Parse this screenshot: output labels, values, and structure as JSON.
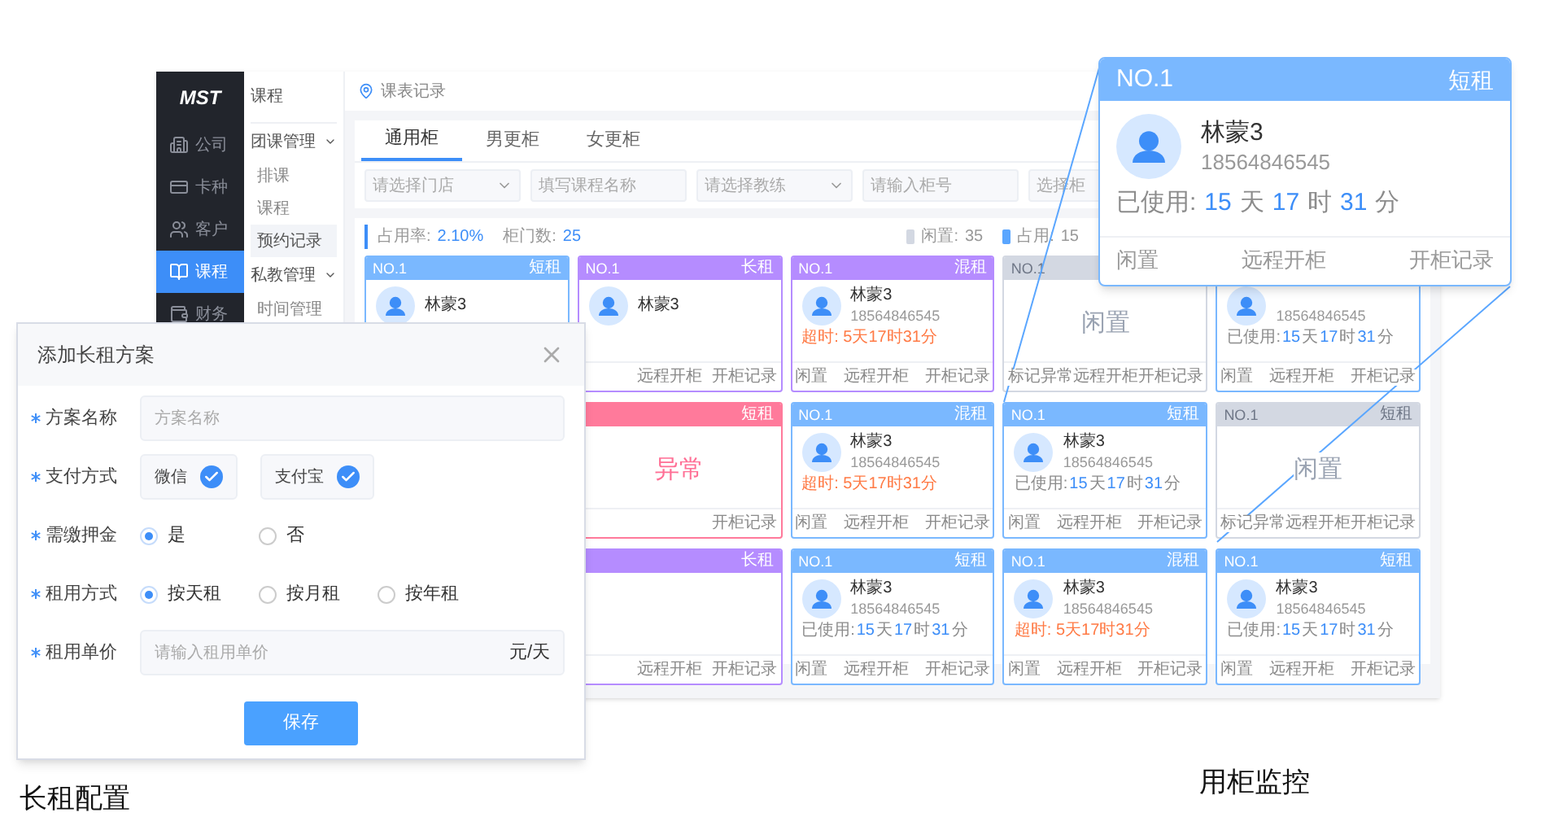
{
  "main_window": {
    "logo": "MST",
    "nav": [
      {
        "label": "公司",
        "selected": false
      },
      {
        "label": "卡种",
        "selected": false
      },
      {
        "label": "客户",
        "selected": false
      },
      {
        "label": "课程",
        "selected": true
      },
      {
        "label": "财务",
        "selected": false
      }
    ],
    "submenu": {
      "title": "课程",
      "groups": [
        {
          "label": "团课管理",
          "expanded": true,
          "children": [
            {
              "label": "排课",
              "selected": false
            },
            {
              "label": "课程",
              "selected": false
            },
            {
              "label": "预约记录",
              "selected": true
            }
          ]
        },
        {
          "label": "私教管理",
          "expanded": true,
          "children": [
            {
              "label": "时间管理",
              "selected": false
            }
          ]
        }
      ]
    },
    "breadcrumb": "课表记录",
    "tabs": [
      {
        "label": "通用柜",
        "selected": true
      },
      {
        "label": "男更柜",
        "selected": false
      },
      {
        "label": "女更柜",
        "selected": false
      }
    ],
    "filters": [
      {
        "kind": "select",
        "placeholder": "请选择门店"
      },
      {
        "kind": "input",
        "placeholder": "填写课程名称"
      },
      {
        "kind": "select",
        "placeholder": "请选择教练"
      },
      {
        "kind": "input",
        "placeholder": "请输入柜号"
      },
      {
        "kind": "input",
        "placeholder": "选择柜"
      }
    ],
    "stats": {
      "summary": [
        {
          "label": "占用率:",
          "value": "2.10%"
        },
        {
          "label": "柜门数:",
          "value": "25"
        }
      ],
      "legend": [
        {
          "label": "闲置:",
          "value": "35",
          "color": "#d3d8e2"
        },
        {
          "label": "占用:",
          "value": "15",
          "color": "#5aa6ff"
        }
      ]
    },
    "card_columns": [
      [
        {
          "kind": "occupied",
          "color": "#7ab8ff",
          "no": "NO.1",
          "type": "短租",
          "name": "林蒙3"
        }
      ],
      [
        {
          "kind": "occupied",
          "color": "#b58cff",
          "no": "NO.1",
          "type": "长租",
          "name": "林蒙3",
          "actions": [
            "远程开柜",
            "开柜记录"
          ]
        },
        {
          "kind": "abnormal",
          "color": "#ff7a9b",
          "type": "短租",
          "status": "异常",
          "actions": [
            "开柜记录"
          ]
        },
        {
          "kind": "occupied",
          "color": "#b58cff",
          "type": "长租",
          "actions": [
            "远程开柜",
            "开柜记录"
          ]
        }
      ],
      [
        {
          "kind": "occupied",
          "color": "#b58cff",
          "no": "NO.1",
          "type": "混租",
          "name": "林蒙3",
          "phone": "18564846545",
          "usage": {
            "kind": "overtime",
            "text": "超时: 5天17时31分"
          },
          "actions": [
            "闲置",
            "远程开柜",
            "开柜记录"
          ]
        },
        {
          "kind": "occupied",
          "color": "#7ab8ff",
          "no": "NO.1",
          "type": "混租",
          "name": "林蒙3",
          "phone": "18564846545",
          "usage": {
            "kind": "overtime",
            "text": "超时: 5天17时31分"
          },
          "actions": [
            "闲置",
            "远程开柜",
            "开柜记录"
          ]
        },
        {
          "kind": "occupied",
          "color": "#7ab8ff",
          "no": "NO.1",
          "type": "短租",
          "name": "林蒙3",
          "phone": "18564846545",
          "usage": {
            "kind": "used",
            "label": "已使用:",
            "parts": [
              "15",
              "天",
              "17",
              "时",
              "31",
              "分"
            ]
          },
          "actions": [
            "闲置",
            "远程开柜",
            "开柜记录"
          ]
        }
      ],
      [
        {
          "kind": "idle",
          "color": "#d3d8e2",
          "no": "NO.1",
          "status": "闲置",
          "actions": [
            "标记异常",
            "远程开柜",
            "开柜记录"
          ]
        },
        {
          "kind": "occupied",
          "color": "#7ab8ff",
          "no": "NO.1",
          "type": "短租",
          "name": "林蒙3",
          "phone": "18564846545",
          "usage": {
            "kind": "used",
            "label": "已使用:",
            "parts": [
              "15",
              "天",
              "17",
              "时",
              "31",
              "分"
            ]
          },
          "actions": [
            "闲置",
            "远程开柜",
            "开柜记录"
          ]
        },
        {
          "kind": "occupied",
          "color": "#7ab8ff",
          "no": "NO.1",
          "type": "混租",
          "name": "林蒙3",
          "phone": "18564846545",
          "usage": {
            "kind": "overtime",
            "text": "超时: 5天17时31分"
          },
          "actions": [
            "闲置",
            "远程开柜",
            "开柜记录"
          ]
        }
      ],
      [
        {
          "kind": "occupied",
          "color": "#7ab8ff",
          "phone": "18564846545",
          "usage": {
            "kind": "used",
            "label": "已使用:",
            "parts": [
              "15",
              "天",
              "17",
              "时",
              "31",
              "分"
            ]
          },
          "actions": [
            "闲置",
            "远程开柜",
            "开柜记录"
          ]
        },
        {
          "kind": "idle",
          "color": "#d3d8e2",
          "no": "NO.1",
          "type": "短租",
          "status": "闲置",
          "actions": [
            "标记异常",
            "远程开柜",
            "开柜记录"
          ]
        },
        {
          "kind": "occupied",
          "color": "#7ab8ff",
          "no": "NO.1",
          "type": "短租",
          "name": "林蒙3",
          "phone": "18564846545",
          "usage": {
            "kind": "used",
            "label": "已使用:",
            "parts": [
              "15",
              "天",
              "17",
              "时",
              "31",
              "分"
            ]
          },
          "actions": [
            "闲置",
            "远程开柜",
            "开柜记录"
          ]
        }
      ]
    ]
  },
  "dialog": {
    "title": "添加长租方案",
    "fields": [
      {
        "kind": "input",
        "label": "方案名称",
        "required": true,
        "placeholder": "方案名称"
      },
      {
        "kind": "checks",
        "label": "支付方式",
        "required": true,
        "options": [
          {
            "label": "微信",
            "checked": true
          },
          {
            "label": "支付宝",
            "checked": true
          }
        ]
      },
      {
        "kind": "radio",
        "label": "需缴押金",
        "required": true,
        "options": [
          {
            "label": "是",
            "selected": true
          },
          {
            "label": "否",
            "selected": false
          }
        ]
      },
      {
        "kind": "radio",
        "label": "租用方式",
        "required": true,
        "options": [
          {
            "label": "按天租",
            "selected": true
          },
          {
            "label": "按月租",
            "selected": false
          },
          {
            "label": "按年租",
            "selected": false
          }
        ]
      },
      {
        "kind": "input",
        "label": "租用单价",
        "required": true,
        "placeholder": "请输入租用单价",
        "suffix": "元/天"
      }
    ],
    "submit": "保存",
    "caption": "长租配置"
  },
  "callout": {
    "color": "#7ab8ff",
    "no": "NO.1",
    "type": "短租",
    "name": "林蒙3",
    "phone": "18564846545",
    "usage": {
      "kind": "used",
      "label": "已使用:",
      "parts": [
        "15",
        "天",
        "17",
        "时",
        "31",
        "分"
      ]
    },
    "actions": [
      "闲置",
      "远程开柜",
      "开柜记录"
    ],
    "caption": "用柜监控"
  }
}
